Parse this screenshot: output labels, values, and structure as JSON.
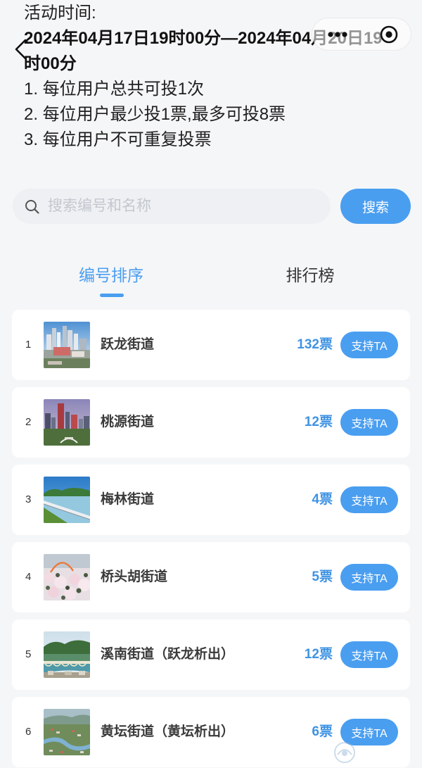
{
  "nav": {
    "back_icon": "chevron-left-icon",
    "more_icon": "more-dots-icon",
    "close_icon": "target-circle-icon"
  },
  "intro": {
    "time_label": "活动时间:",
    "time_range": "2024年04月17日19时00分—2024年04月20日19时00分",
    "rules": [
      "1. 每位用户总共可投1次",
      "2. 每位用户最少投1票,最多可投8票",
      "3. 每位用户不可重复投票"
    ]
  },
  "search": {
    "icon": "search-icon",
    "placeholder": "搜索编号和名称",
    "button_label": "搜索"
  },
  "tabs": [
    {
      "label": "编号排序",
      "active": true
    },
    {
      "label": "排行榜",
      "active": false
    }
  ],
  "items": [
    {
      "rank": "1",
      "name": "跃龙街道",
      "votes": "132票",
      "button_label": "支持TA"
    },
    {
      "rank": "2",
      "name": "桃源街道",
      "votes": "12票",
      "button_label": "支持TA"
    },
    {
      "rank": "3",
      "name": "梅林街道",
      "votes": "4票",
      "button_label": "支持TA"
    },
    {
      "rank": "4",
      "name": "桥头胡街道",
      "votes": "5票",
      "button_label": "支持TA"
    },
    {
      "rank": "5",
      "name": "溪南街道（跃龙析出）",
      "votes": "12票",
      "button_label": "支持TA"
    },
    {
      "rank": "6",
      "name": "黄坛街道（黄坛析出）",
      "votes": "6票",
      "button_label": "支持TA"
    }
  ],
  "colors": {
    "accent": "#4a9ef0",
    "votes": "#3f93e3",
    "page_background": "#f5f6f8",
    "card_background": "#ffffff",
    "text": "#333333"
  }
}
